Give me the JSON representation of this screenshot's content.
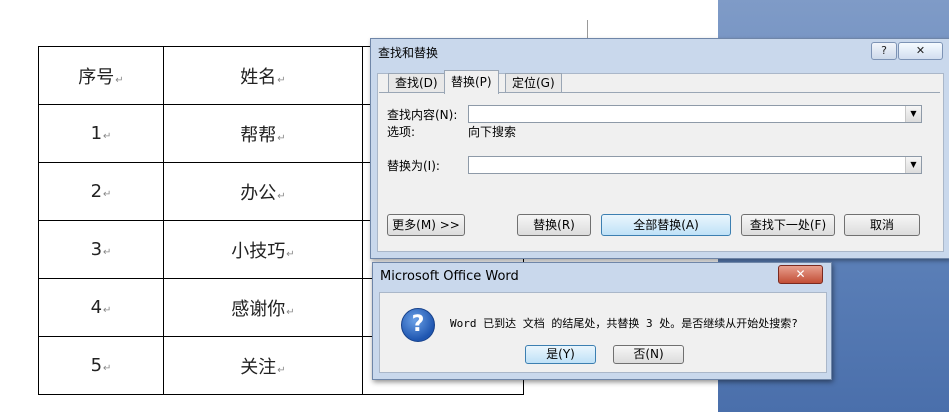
{
  "document": {
    "table": {
      "rows": [
        {
          "c1": "序号",
          "c2": "姓名"
        },
        {
          "c1": "1",
          "c2": "帮帮"
        },
        {
          "c1": "2",
          "c2": "办公"
        },
        {
          "c1": "3",
          "c2": "小技巧"
        },
        {
          "c1": "4",
          "c2": "感谢你"
        },
        {
          "c1": "5",
          "c2": "关注"
        }
      ],
      "paragraph_mark": "↵"
    }
  },
  "find_replace_dialog": {
    "title": "查找和替换",
    "title_buttons": {
      "help": "?",
      "close": "✕"
    },
    "tabs": [
      "查找(D)",
      "替换(P)",
      "定位(G)"
    ],
    "find_label": "查找内容(N):",
    "options_label": "选项:",
    "options_value": "向下搜索",
    "replace_label": "替换为(I):",
    "find_value": "",
    "replace_value": "",
    "buttons": {
      "more": "更多(M) >>",
      "replace": "替换(R)",
      "replace_all": "全部替换(A)",
      "find_next": "查找下一处(F)",
      "cancel": "取消"
    }
  },
  "message_box": {
    "title": "Microsoft Office Word",
    "close": "✕",
    "icon": "question-icon",
    "text": "Word 已到达 文档 的结尾处，共替换 3 处。是否继续从开始处搜索?",
    "yes": "是(Y)",
    "no": "否(N)"
  }
}
